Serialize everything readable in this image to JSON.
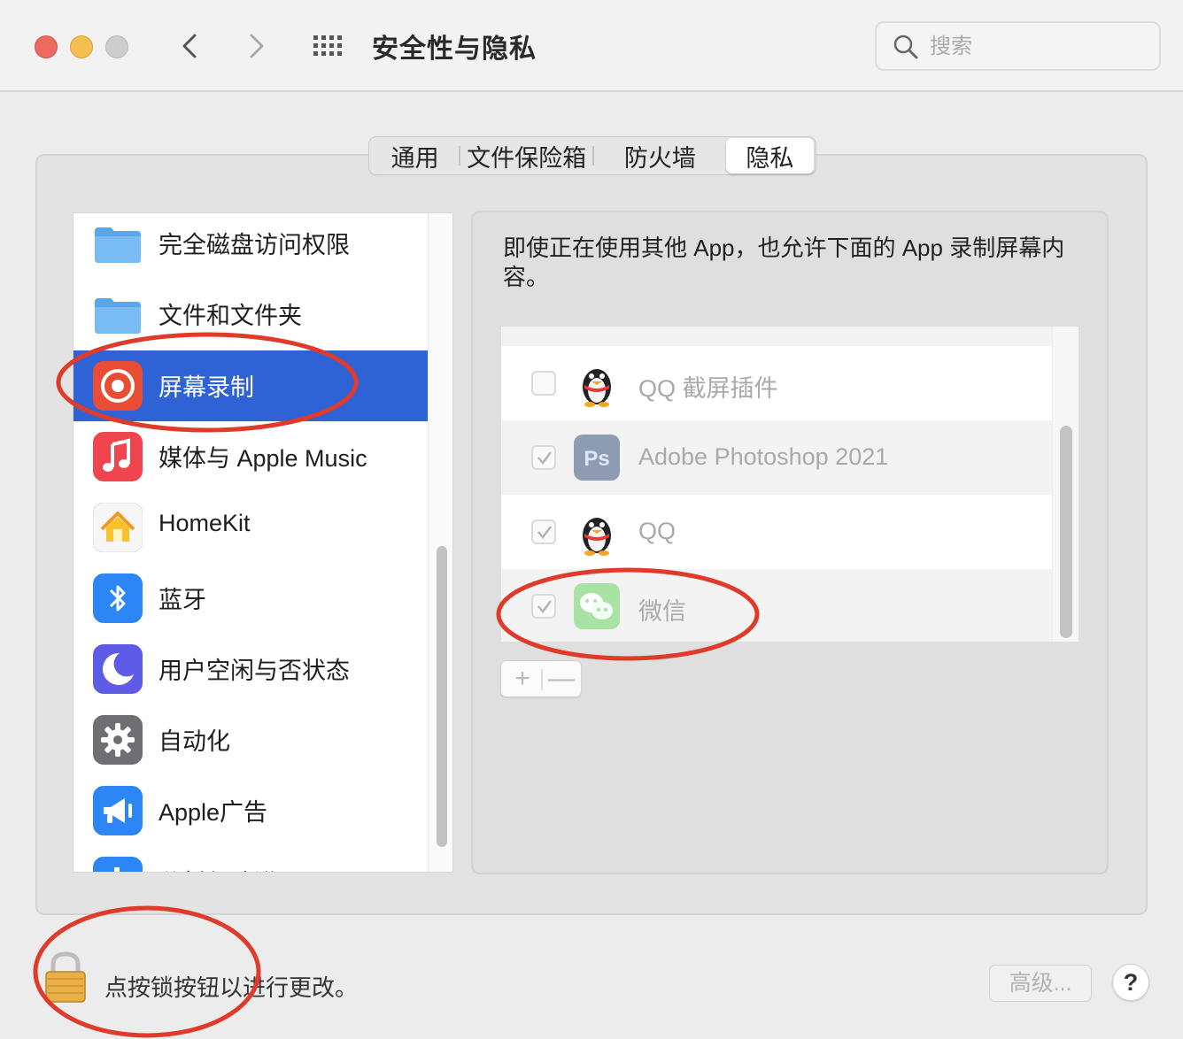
{
  "window": {
    "title": "安全性与隐私",
    "search_placeholder": "搜索"
  },
  "tabs": [
    {
      "label": "通用"
    },
    {
      "label": "文件保险箱"
    },
    {
      "label": "防火墙"
    },
    {
      "label": "隐私",
      "selected": true
    }
  ],
  "sidebar": {
    "items": [
      {
        "label": "完全磁盘访问权限",
        "icon": "folder-icon"
      },
      {
        "label": "文件和文件夹",
        "icon": "folder-icon"
      },
      {
        "label": "屏幕录制",
        "icon": "screen-record-icon",
        "selected": true
      },
      {
        "label": "媒体与 Apple Music",
        "icon": "music-icon"
      },
      {
        "label": "HomeKit",
        "icon": "home-icon"
      },
      {
        "label": "蓝牙",
        "icon": "bluetooth-icon"
      },
      {
        "label": "用户空闲与否状态",
        "icon": "moon-icon"
      },
      {
        "label": "自动化",
        "icon": "gear-icon"
      },
      {
        "label": "Apple广告",
        "icon": "megaphone-icon"
      },
      {
        "label": "分析与改进",
        "icon": "analytics-icon"
      }
    ]
  },
  "privacy": {
    "description": "即使正在使用其他 App，也允许下面的 App 录制屏幕内容。",
    "apps": [
      {
        "name": "QQ 截屏插件",
        "checked": false,
        "icon": "qq-penguin-icon"
      },
      {
        "name": "Adobe Photoshop 2021",
        "checked": true,
        "icon": "photoshop-icon"
      },
      {
        "name": "QQ",
        "checked": true,
        "icon": "qq-penguin-icon"
      },
      {
        "name": "微信",
        "checked": true,
        "icon": "wechat-icon"
      }
    ],
    "add_label": "+",
    "remove_label": "—"
  },
  "footer": {
    "lock_text": "点按锁按钮以进行更改。",
    "advanced_label": "高级...",
    "help_label": "?"
  },
  "colors": {
    "selection": "#2f62d4",
    "annotation": "#e03a2a",
    "background": "#ececec"
  }
}
